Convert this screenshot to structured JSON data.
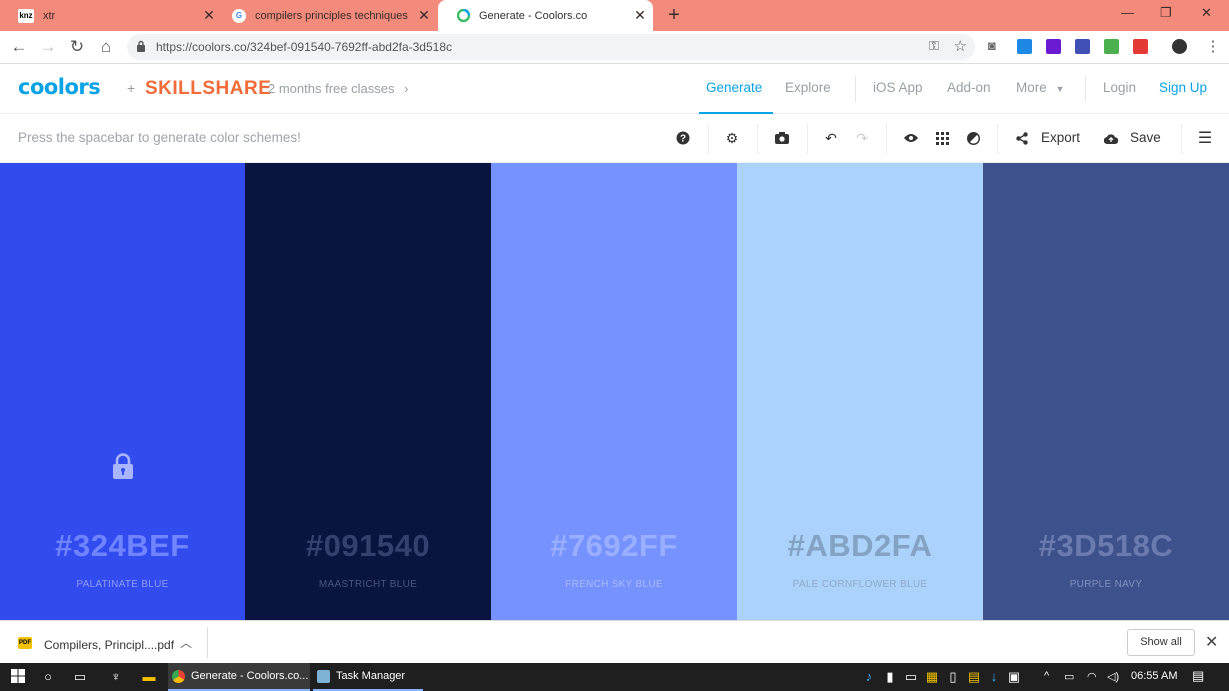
{
  "browser": {
    "tabs": [
      {
        "favicon": "knz",
        "title": "xtr"
      },
      {
        "favicon": "G",
        "title": "compilers principles techniques a"
      },
      {
        "favicon": "coolors",
        "title": "Generate - Coolors.co"
      }
    ],
    "new_tab": "+",
    "url": "https://coolors.co/324bef-091540-7692ff-abd2fa-3d518c"
  },
  "header": {
    "logo": "coolors",
    "plus": "+",
    "partner": "SKILLSHARE",
    "promo": "2 months free classes",
    "promo_chevron": "›",
    "nav": {
      "generate": "Generate",
      "explore": "Explore",
      "ios_app": "iOS App",
      "addon": "Add-on",
      "more": "More",
      "login": "Login",
      "signup": "Sign Up"
    }
  },
  "toolbar": {
    "hint": "Press the spacebar to generate color schemes!",
    "export": "Export",
    "save": "Save"
  },
  "palette": [
    {
      "hex": "#324BEF",
      "name": "PALATINATE BLUE",
      "color": "#324bef",
      "hex_color": "#6f84ff",
      "name_color": "#8e9cf7",
      "locked": true
    },
    {
      "hex": "#091540",
      "name": "MAASTRICHT BLUE",
      "color": "#091540",
      "hex_color": "#35406e",
      "name_color": "#4a5480",
      "locked": false
    },
    {
      "hex": "#7692FF",
      "name": "FRENCH SKY BLUE",
      "color": "#7692ff",
      "hex_color": "#9aafff",
      "name_color": "#a9bbff",
      "locked": false
    },
    {
      "hex": "#ABD2FA",
      "name": "PALE CORNFLOWER BLUE",
      "color": "#abd2fa",
      "hex_color": "#84a3c4",
      "name_color": "#8fa9c6",
      "locked": false
    },
    {
      "hex": "#3D518C",
      "name": "PURPLE NAVY",
      "color": "#3d518c",
      "hex_color": "#6b7bb0",
      "name_color": "#8290bf",
      "locked": false
    }
  ],
  "download_shelf": {
    "file_icon": "PDF",
    "file": "Compilers, Principl....pdf",
    "show_all": "Show all"
  },
  "taskbar": {
    "apps": [
      {
        "label": "Generate - Coolors.co..."
      },
      {
        "label": "Task Manager"
      }
    ],
    "time": "06:55 AM"
  }
}
